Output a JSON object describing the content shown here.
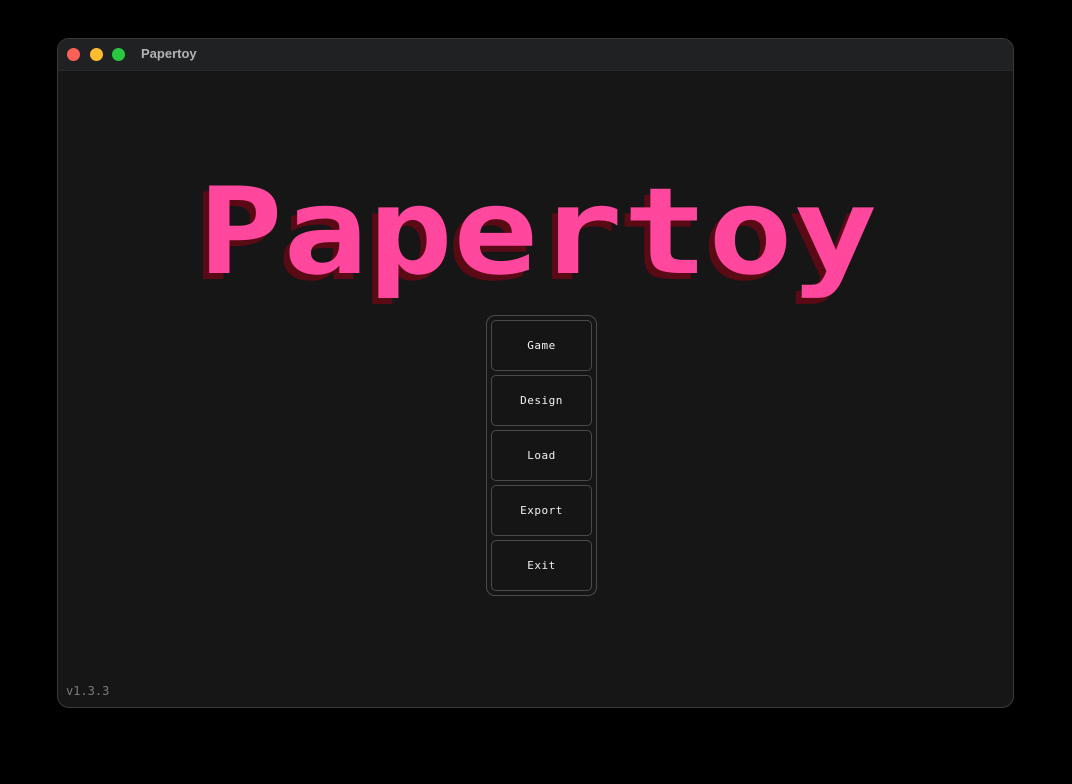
{
  "window": {
    "title": "Papertoy"
  },
  "logo": {
    "text": "Papertoy",
    "color": "#ff479e",
    "shadow_color": "#5a0a14"
  },
  "menu": {
    "items": [
      {
        "label": "Game"
      },
      {
        "label": "Design"
      },
      {
        "label": "Load"
      },
      {
        "label": "Export"
      },
      {
        "label": "Exit"
      }
    ]
  },
  "footer": {
    "version": "v1.3.3"
  }
}
